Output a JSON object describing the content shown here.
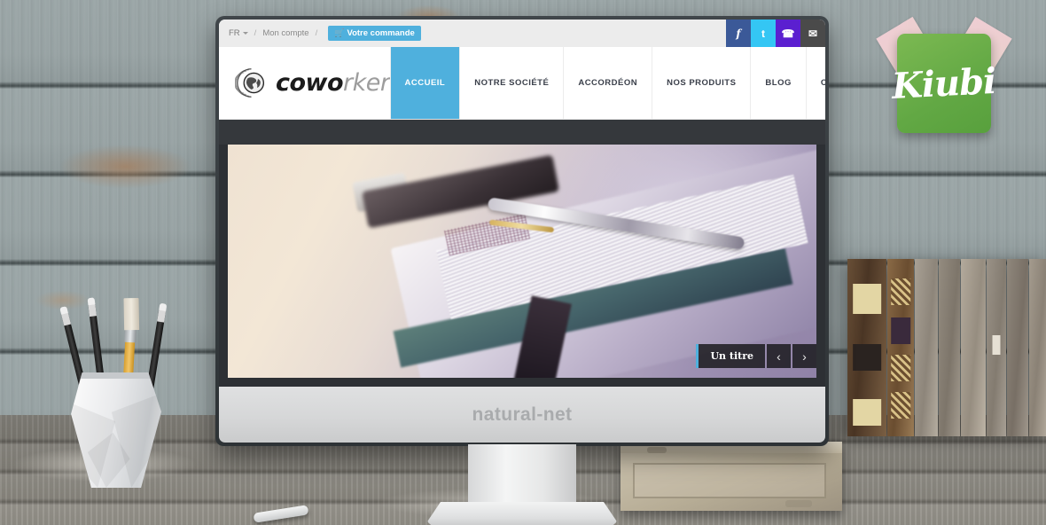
{
  "scene": {
    "description": "Weathered blue-gray painted wood wall with an iMac displaying a website",
    "brand_sticker": {
      "label": "Kiubi",
      "card_color": "#62a844",
      "tape_color": "#f7d1d8"
    },
    "monitor": {
      "chin_label": "natural-net",
      "bezel_color": "#d6d7d8",
      "body_color": "#35383c"
    }
  },
  "site": {
    "topbar": {
      "language": "FR",
      "separator": "/",
      "account_label": "Mon compte",
      "cart_icon": "shopping-cart-icon",
      "cart_label": "Votre commande",
      "cart_color": "#4fb0dd",
      "social": [
        {
          "name": "facebook",
          "glyph": "f",
          "color": "#3b5998"
        },
        {
          "name": "twitter",
          "glyph": "t",
          "color": "#34c6f4"
        },
        {
          "name": "phone",
          "glyph": "☎",
          "color": "#5b1fd0"
        },
        {
          "name": "email",
          "glyph": "✉",
          "color": "#4a4a4a"
        }
      ]
    },
    "logo": {
      "icon": "globe-icon",
      "text_bold": "cowo",
      "text_light": "rker"
    },
    "nav": {
      "items": [
        {
          "label": "ACCUEIL",
          "active": true
        },
        {
          "label": "NOTRE SOCIÉTÉ",
          "active": false
        },
        {
          "label": "ACCORDÉON",
          "active": false
        },
        {
          "label": "NOS PRODUITS",
          "active": false
        },
        {
          "label": "BLOG",
          "active": false
        },
        {
          "label": "CONTACT",
          "active": false
        }
      ],
      "active_color": "#4fb0dd"
    },
    "slider": {
      "image_description": "Close-up of a silver pen resting on an open planner notebook with a smartphone on a desk",
      "caption": "Un titre",
      "prev_icon": "chevron-left-icon",
      "next_icon": "chevron-right-icon",
      "prev_glyph": "‹",
      "next_glyph": "›",
      "accent_color": "#4fb0dd"
    }
  }
}
